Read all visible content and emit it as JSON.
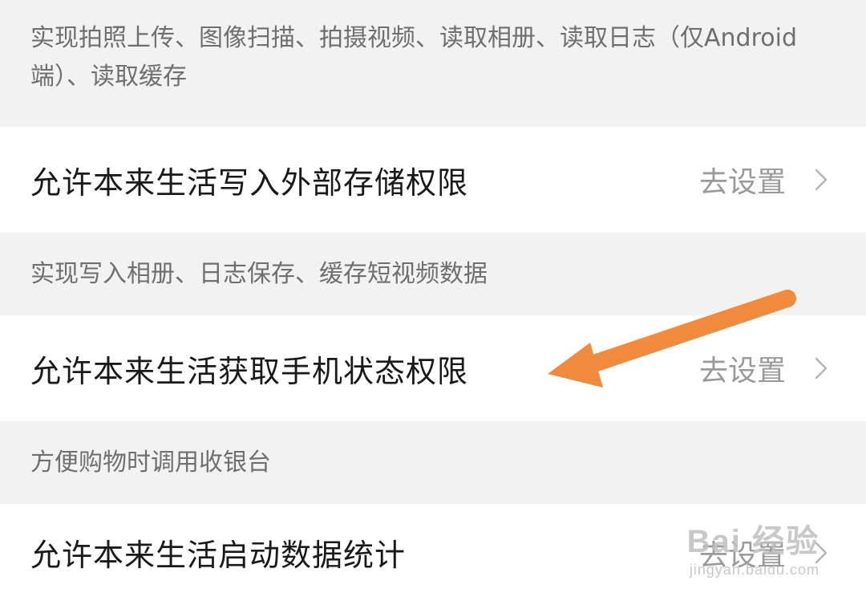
{
  "sections": [
    {
      "description": "实现拍照上传、图像扫描、拍摄视频、读取相册、读取日志（仅Android端）、读取缓存"
    },
    {
      "title": "允许本来生活写入外部存储权限",
      "action": "去设置",
      "description": "实现写入相册、日志保存、缓存短视频数据"
    },
    {
      "title": "允许本来生活获取手机状态权限",
      "action": "去设置",
      "description": "方便购物时调用收银台"
    },
    {
      "title": "允许本来生活启动数据统计",
      "action": "去设置"
    }
  ],
  "watermark": {
    "text": "Bai 经验",
    "url": "jingyan.baidu.com"
  },
  "colors": {
    "arrow": "#f08a3c",
    "background": "#f2f2f2",
    "row": "#ffffff"
  }
}
